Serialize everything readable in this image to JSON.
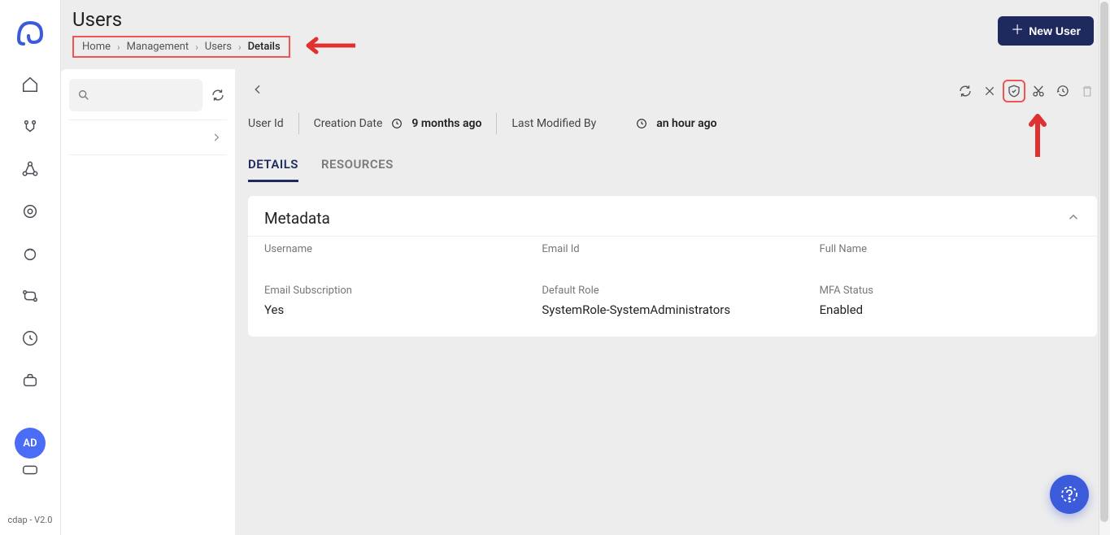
{
  "page": {
    "title": "Users"
  },
  "breadcrumb": {
    "items": [
      "Home",
      "Management",
      "Users",
      "Details"
    ]
  },
  "header": {
    "new_user_label": "New User"
  },
  "avatar": {
    "initials": "AD"
  },
  "footer": {
    "version": "cdap - V2.0"
  },
  "info": {
    "user_id_label": "User Id",
    "creation_label": "Creation Date",
    "creation_value": "9 months ago",
    "modified_label": "Last Modified By",
    "modified_value": "an hour ago"
  },
  "tabs": {
    "details": "DETAILS",
    "resources": "RESOURCES"
  },
  "card": {
    "title": "Metadata"
  },
  "metadata": {
    "username_label": "Username",
    "username_value": "",
    "email_label": "Email Id",
    "email_value": "",
    "fullname_label": "Full Name",
    "fullname_value": "",
    "emailsub_label": "Email Subscription",
    "emailsub_value": "Yes",
    "role_label": "Default Role",
    "role_value": "SystemRole-SystemAdministrators",
    "mfa_label": "MFA Status",
    "mfa_value": "Enabled"
  }
}
